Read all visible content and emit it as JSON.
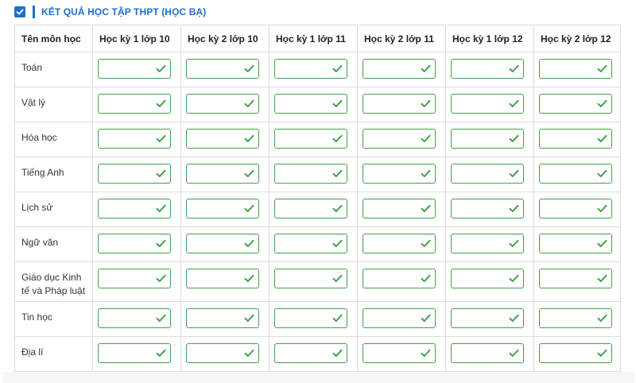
{
  "section": {
    "title": "KẾT QUẢ HỌC TẬP THPT (HỌC BẠ)",
    "checked": true,
    "accent_color": "#1e6fc9"
  },
  "table": {
    "headers": [
      "Tên môn học",
      "Học kỳ 1 lớp 10",
      "Học kỳ 2 lớp 10",
      "Học kỳ 1 lớp 11",
      "Học kỳ 2 lớp 11",
      "Học kỳ 1 lớp 12",
      "Học kỳ 2 lớp 12"
    ],
    "rows": [
      {
        "subject": "Toán",
        "values": [
          "",
          "",
          "",
          "",
          "",
          ""
        ]
      },
      {
        "subject": "Vật lý",
        "values": [
          "",
          "",
          "",
          "",
          "",
          ""
        ]
      },
      {
        "subject": "Hóa học",
        "values": [
          "",
          "",
          "",
          "",
          "",
          ""
        ]
      },
      {
        "subject": "Tiếng Anh",
        "values": [
          "",
          "",
          "",
          "",
          "",
          ""
        ]
      },
      {
        "subject": "Lịch sử",
        "values": [
          "",
          "",
          "",
          "",
          "",
          ""
        ]
      },
      {
        "subject": "Ngữ văn",
        "values": [
          "",
          "",
          "",
          "",
          "",
          ""
        ]
      },
      {
        "subject": "Giáo dục Kinh tế và Pháp luật",
        "values": [
          "",
          "",
          "",
          "",
          "",
          ""
        ]
      },
      {
        "subject": "Tin học",
        "values": [
          "",
          "",
          "",
          "",
          "",
          ""
        ]
      },
      {
        "subject": "Địa lí",
        "values": [
          "",
          "",
          "",
          "",
          "",
          ""
        ]
      }
    ],
    "valid_icon": "check-icon",
    "valid_color": "#43a047"
  }
}
